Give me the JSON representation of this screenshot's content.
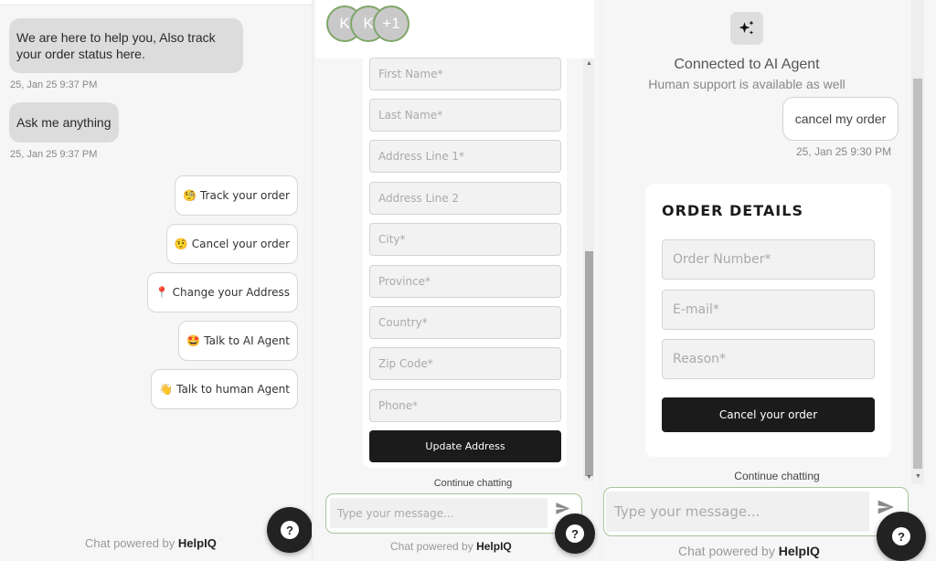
{
  "panel1": {
    "messages": [
      {
        "text": "We are here to help you, Also track your order status here.",
        "time": "25, Jan 25 9:37 PM"
      },
      {
        "text": "Ask me anything",
        "time": "25, Jan 25 9:37 PM"
      }
    ],
    "quick_replies": [
      {
        "emoji": "🧐",
        "label": "Track your order"
      },
      {
        "emoji": "🤨",
        "label": "Cancel your order"
      },
      {
        "emoji": "📍",
        "label": "Change your Address"
      },
      {
        "emoji": "🤩",
        "label": "Talk to AI Agent"
      },
      {
        "emoji": "👋",
        "label": "Talk to human Agent"
      }
    ],
    "powered_prefix": "Chat powered by ",
    "powered_brand": "HelpIQ",
    "help_icon": "?"
  },
  "panel2": {
    "avatars": [
      "K",
      "K",
      "+1"
    ],
    "fields": [
      {
        "placeholder": "First Name*"
      },
      {
        "placeholder": "Last Name*"
      },
      {
        "placeholder": "Address Line 1*"
      },
      {
        "placeholder": "Address Line 2"
      },
      {
        "placeholder": "City*"
      },
      {
        "placeholder": "Province*"
      },
      {
        "placeholder": "Country*"
      },
      {
        "placeholder": "Zip Code*"
      },
      {
        "placeholder": "Phone*"
      }
    ],
    "submit_label": "Update Address",
    "continue_label": "Continue chatting",
    "message_placeholder": "Type your message...",
    "powered_prefix": "Chat powered by ",
    "powered_brand": "HelpIQ",
    "help_icon": "?"
  },
  "panel3": {
    "connected_title": "Connected to AI Agent",
    "connected_subtitle": "Human support is available as well",
    "user_message": "cancel my order",
    "user_message_time": "25, Jan 25 9:30 PM",
    "order_title": "ORDER DETAILS",
    "fields": [
      {
        "placeholder": "Order Number*"
      },
      {
        "placeholder": "E-mail*"
      },
      {
        "placeholder": "Reason*"
      }
    ],
    "submit_label": "Cancel your order",
    "continue_label": "Continue chatting",
    "message_placeholder": "Type your message...",
    "powered_prefix": "Chat powered by ",
    "powered_brand": "HelpIQ",
    "help_icon": "?"
  }
}
